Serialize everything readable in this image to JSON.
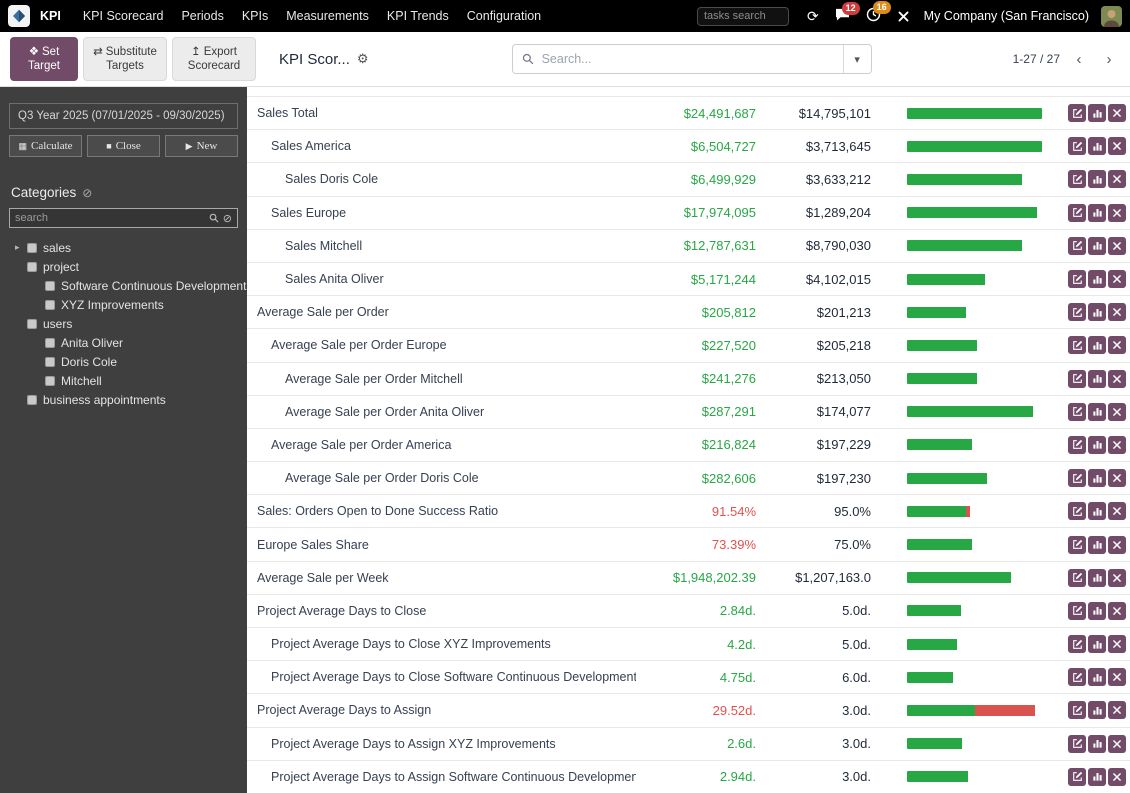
{
  "colors": {
    "good": "#28a745",
    "bad": "#e0524e",
    "bar_green": "#28a745",
    "bar_red": "#d9534f",
    "accent": "#714B67",
    "badge_red": "#d13c3c",
    "badge_orange": "#dd8d17"
  },
  "navbar": {
    "app": "KPI",
    "menu": [
      "KPI Scorecard",
      "Periods",
      "KPIs",
      "Measurements",
      "KPI Trends",
      "Configuration"
    ],
    "tasks_search_placeholder": "tasks search",
    "message_badge": "12",
    "activity_badge": "16",
    "company": "My Company (San Francisco)"
  },
  "control_panel": {
    "buttons": {
      "set_target": "Set Target",
      "substitute_targets": "Substitute Targets",
      "export_scorecard": "Export Scorecard"
    },
    "breadcrumb": "KPI Scor...",
    "search_placeholder": "Search...",
    "pager": "1-27 / 27"
  },
  "icons": {
    "set_target": "❖",
    "substitute": "⇄",
    "export": "↥",
    "gear": "⚙",
    "dropdown_caret": "▾",
    "pager_prev": "‹",
    "pager_next": "›",
    "sync": "⟳",
    "calculate": "▦",
    "close": "■",
    "new": "▶",
    "clear": "⊘",
    "tree_caret": "▸"
  },
  "sidebar": {
    "period": "Q3 Year 2025 (07/01/2025 - 09/30/2025)",
    "calculate": "Calculate",
    "close": "Close",
    "new": "New",
    "categories_title": "Categories",
    "search_placeholder": "search",
    "tree": [
      {
        "label": "sales",
        "level": 0,
        "caret": true
      },
      {
        "label": "project",
        "level": 0,
        "caret": false
      },
      {
        "label": "Software Continuous Development",
        "level": 1,
        "caret": false
      },
      {
        "label": "XYZ Improvements",
        "level": 1,
        "caret": false
      },
      {
        "label": "users",
        "level": 0,
        "caret": false
      },
      {
        "label": "Anita Oliver",
        "level": 1,
        "caret": false
      },
      {
        "label": "Doris Cole",
        "level": 1,
        "caret": false
      },
      {
        "label": "Mitchell",
        "level": 1,
        "caret": false
      },
      {
        "label": "business appointments",
        "level": 0,
        "caret": false
      }
    ]
  },
  "rows": [
    {
      "name": "Sales Total",
      "indent": 0,
      "value": "$24,491,687",
      "state": "good",
      "target": "$14,795,101",
      "bar": {
        "green": 100,
        "red": 0,
        "striped": true
      }
    },
    {
      "name": "Sales America",
      "indent": 1,
      "value": "$6,504,727",
      "state": "good",
      "target": "$3,713,645",
      "bar": {
        "green": 100,
        "red": 0,
        "striped": true
      }
    },
    {
      "name": "Sales Doris Cole",
      "indent": 2,
      "value": "$6,499,929",
      "state": "good",
      "target": "$3,633,212",
      "bar": {
        "green": 85,
        "red": 0,
        "striped": true
      }
    },
    {
      "name": "Sales Europe",
      "indent": 1,
      "value": "$17,974,095",
      "state": "good",
      "target": "$1,289,204",
      "bar": {
        "green": 96,
        "red": 0,
        "striped": true
      }
    },
    {
      "name": "Sales Mitchell",
      "indent": 2,
      "value": "$12,787,631",
      "state": "good",
      "target": "$8,790,030",
      "bar": {
        "green": 85,
        "red": 0,
        "striped": true
      }
    },
    {
      "name": "Sales Anita Oliver",
      "indent": 2,
      "value": "$5,171,244",
      "state": "good",
      "target": "$4,102,015",
      "bar": {
        "green": 58,
        "red": 0,
        "striped": false
      }
    },
    {
      "name": "Average Sale per Order",
      "indent": 0,
      "value": "$205,812",
      "state": "good",
      "target": "$201,213",
      "bar": {
        "green": 44,
        "red": 0,
        "striped": false
      }
    },
    {
      "name": "Average Sale per Order Europe",
      "indent": 1,
      "value": "$227,520",
      "state": "good",
      "target": "$205,218",
      "bar": {
        "green": 52,
        "red": 0,
        "striped": false
      }
    },
    {
      "name": "Average Sale per Order Mitchell",
      "indent": 2,
      "value": "$241,276",
      "state": "good",
      "target": "$213,050",
      "bar": {
        "green": 52,
        "red": 0,
        "striped": false
      }
    },
    {
      "name": "Average Sale per Order Anita Oliver",
      "indent": 2,
      "value": "$287,291",
      "state": "good",
      "target": "$174,077",
      "bar": {
        "green": 93,
        "red": 0,
        "striped": true
      }
    },
    {
      "name": "Average Sale per Order America",
      "indent": 1,
      "value": "$216,824",
      "state": "good",
      "target": "$197,229",
      "bar": {
        "green": 48,
        "red": 0,
        "striped": false
      }
    },
    {
      "name": "Average Sale per Order Doris Cole",
      "indent": 2,
      "value": "$282,606",
      "state": "good",
      "target": "$197,230",
      "bar": {
        "green": 59,
        "red": 0,
        "striped": false
      }
    },
    {
      "name": "Sales: Orders Open to Done Success Ratio",
      "indent": 0,
      "value": "91.54%",
      "state": "bad",
      "target": "95.0%",
      "bar": {
        "green": 44,
        "red": 3,
        "striped": false
      }
    },
    {
      "name": "Europe Sales Share",
      "indent": 0,
      "value": "73.39%",
      "state": "bad",
      "target": "75.0%",
      "bar": {
        "green": 48,
        "red": 0,
        "striped": false
      }
    },
    {
      "name": "Average Sale per Week",
      "indent": 0,
      "value": "$1,948,202.39",
      "state": "good",
      "target": "$1,207,163.0",
      "bar": {
        "green": 77,
        "red": 0,
        "striped": true
      }
    },
    {
      "name": "Project Average Days to Close",
      "indent": 0,
      "value": "2.84d.",
      "state": "good",
      "target": "5.0d.",
      "bar": {
        "green": 40,
        "red": 0,
        "striped": true
      }
    },
    {
      "name": "Project Average Days to Close XYZ Improvements",
      "indent": 1,
      "value": "4.2d.",
      "state": "good",
      "target": "5.0d.",
      "bar": {
        "green": 37,
        "red": 0,
        "striped": false
      }
    },
    {
      "name": "Project Average Days to Close Software Continuous Development",
      "indent": 1,
      "value": "4.75d.",
      "state": "good",
      "target": "6.0d.",
      "bar": {
        "green": 34,
        "red": 0,
        "striped": false
      }
    },
    {
      "name": "Project Average Days to Assign",
      "indent": 0,
      "value": "29.52d.",
      "state": "bad",
      "target": "3.0d.",
      "bar": {
        "green": 50,
        "red": 45,
        "striped": false
      }
    },
    {
      "name": "Project Average Days to Assign XYZ Improvements",
      "indent": 1,
      "value": "2.6d.",
      "state": "good",
      "target": "3.0d.",
      "bar": {
        "green": 41,
        "red": 0,
        "striped": false
      }
    },
    {
      "name": "Project Average Days to Assign Software Continuous Development",
      "indent": 1,
      "value": "2.94d.",
      "state": "good",
      "target": "3.0d.",
      "bar": {
        "green": 45,
        "red": 0,
        "striped": false
      }
    }
  ]
}
